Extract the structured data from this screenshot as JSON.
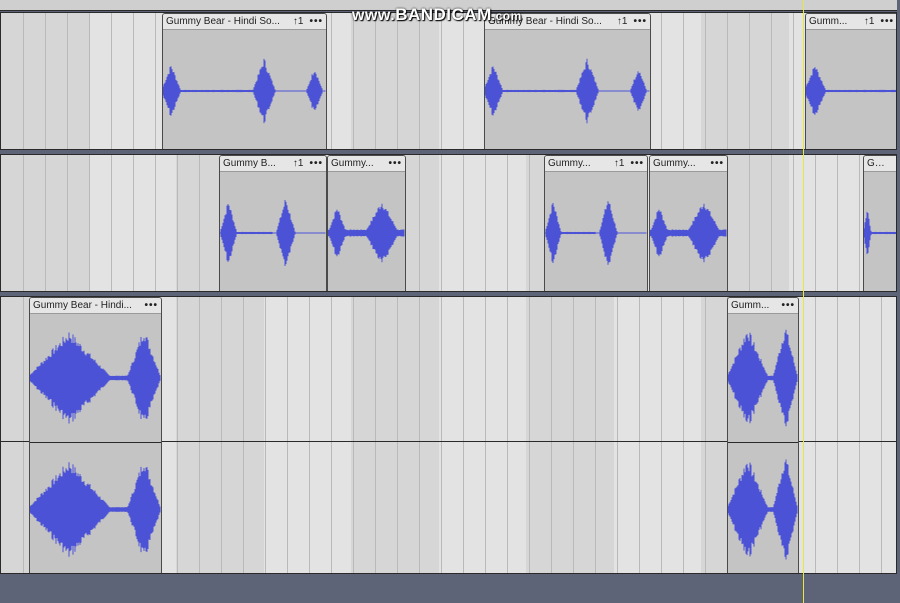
{
  "watermark": {
    "prefix": "www.",
    "brand": "BANDICAM",
    "suffix": ".com"
  },
  "colors": {
    "waveform": "#4b52d6",
    "track_bg": "#d0d0d0",
    "clip_bg": "#c4c4c4",
    "playhead": "#e8e83a",
    "background": "#5e6478"
  },
  "tracks": [
    {
      "id": "track-1",
      "clips": [
        {
          "name": "Gummy Bear - Hindi So...",
          "pitch": "↑1",
          "menu": "•••"
        },
        {
          "name": "Gummy Bear - Hindi So...",
          "pitch": "↑1",
          "menu": "•••"
        },
        {
          "name": "Gumm...",
          "pitch": "↑1",
          "menu": "•••"
        }
      ]
    },
    {
      "id": "track-2",
      "clips": [
        {
          "name": "Gummy B...",
          "pitch": "↑1",
          "menu": "•••"
        },
        {
          "name": "Gummy...",
          "pitch": "",
          "menu": "•••"
        },
        {
          "name": "Gummy...",
          "pitch": "↑1",
          "menu": "•••"
        },
        {
          "name": "Gummy...",
          "pitch": "",
          "menu": "•••"
        },
        {
          "name": "Gu...",
          "pitch": "",
          "menu": ""
        }
      ]
    },
    {
      "id": "track-3",
      "clips": [
        {
          "name": "Gummy Bear - Hindi...",
          "pitch": "",
          "menu": "•••"
        },
        {
          "name": "Gumm...",
          "pitch": "",
          "menu": "•••"
        }
      ]
    }
  ]
}
